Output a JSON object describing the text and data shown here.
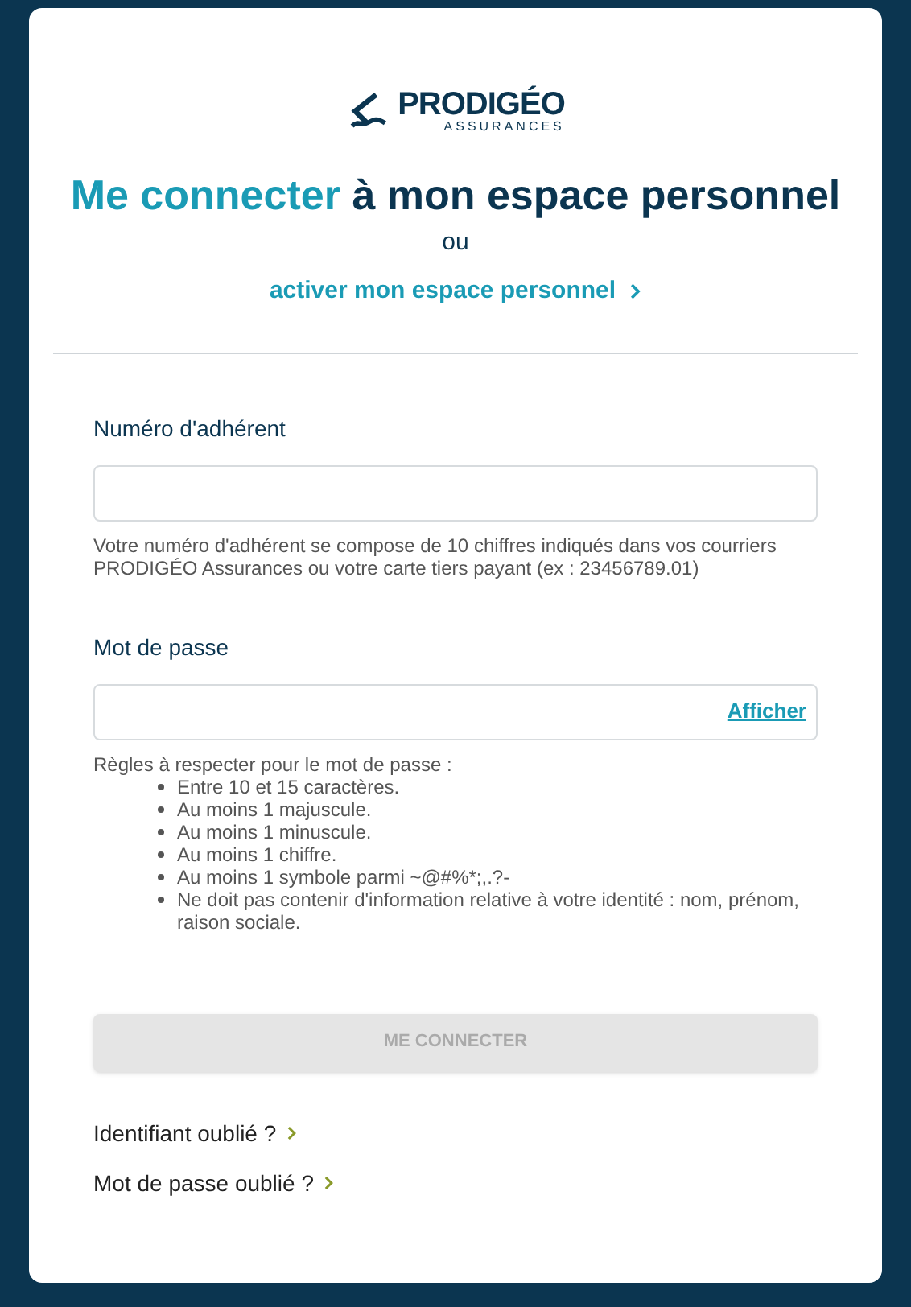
{
  "logo": {
    "name": "PRODIGÉO",
    "tagline": "ASSURANCES"
  },
  "heading": {
    "highlight": "Me connecter",
    "rest": "à mon espace personnel"
  },
  "separator": "ou",
  "activate_link": "activer mon espace personnel",
  "member_field": {
    "label": "Numéro d'adhérent",
    "help": "Votre numéro d'adhérent se compose de 10 chiffres indiqués dans vos courriers PRODIGÉO Assurances ou votre carte tiers payant (ex : 23456789.01)"
  },
  "password_field": {
    "label": "Mot de passe",
    "toggle": "Afficher",
    "rules_title": "Règles à respecter pour le mot de passe :",
    "rules": [
      "Entre 10 et 15 caractères.",
      "Au moins 1 majuscule.",
      "Au moins 1 minuscule.",
      "Au moins 1 chiffre.",
      "Au moins 1 symbole parmi ~@#%*;,.?-",
      "Ne doit pas contenir d'information relative à votre identité : nom, prénom, raison sociale."
    ]
  },
  "submit": {
    "label": "ME CONNECTER",
    "disabled": true
  },
  "links": [
    "Identifiant oublié ?",
    "Mot de passe oublié ?"
  ]
}
